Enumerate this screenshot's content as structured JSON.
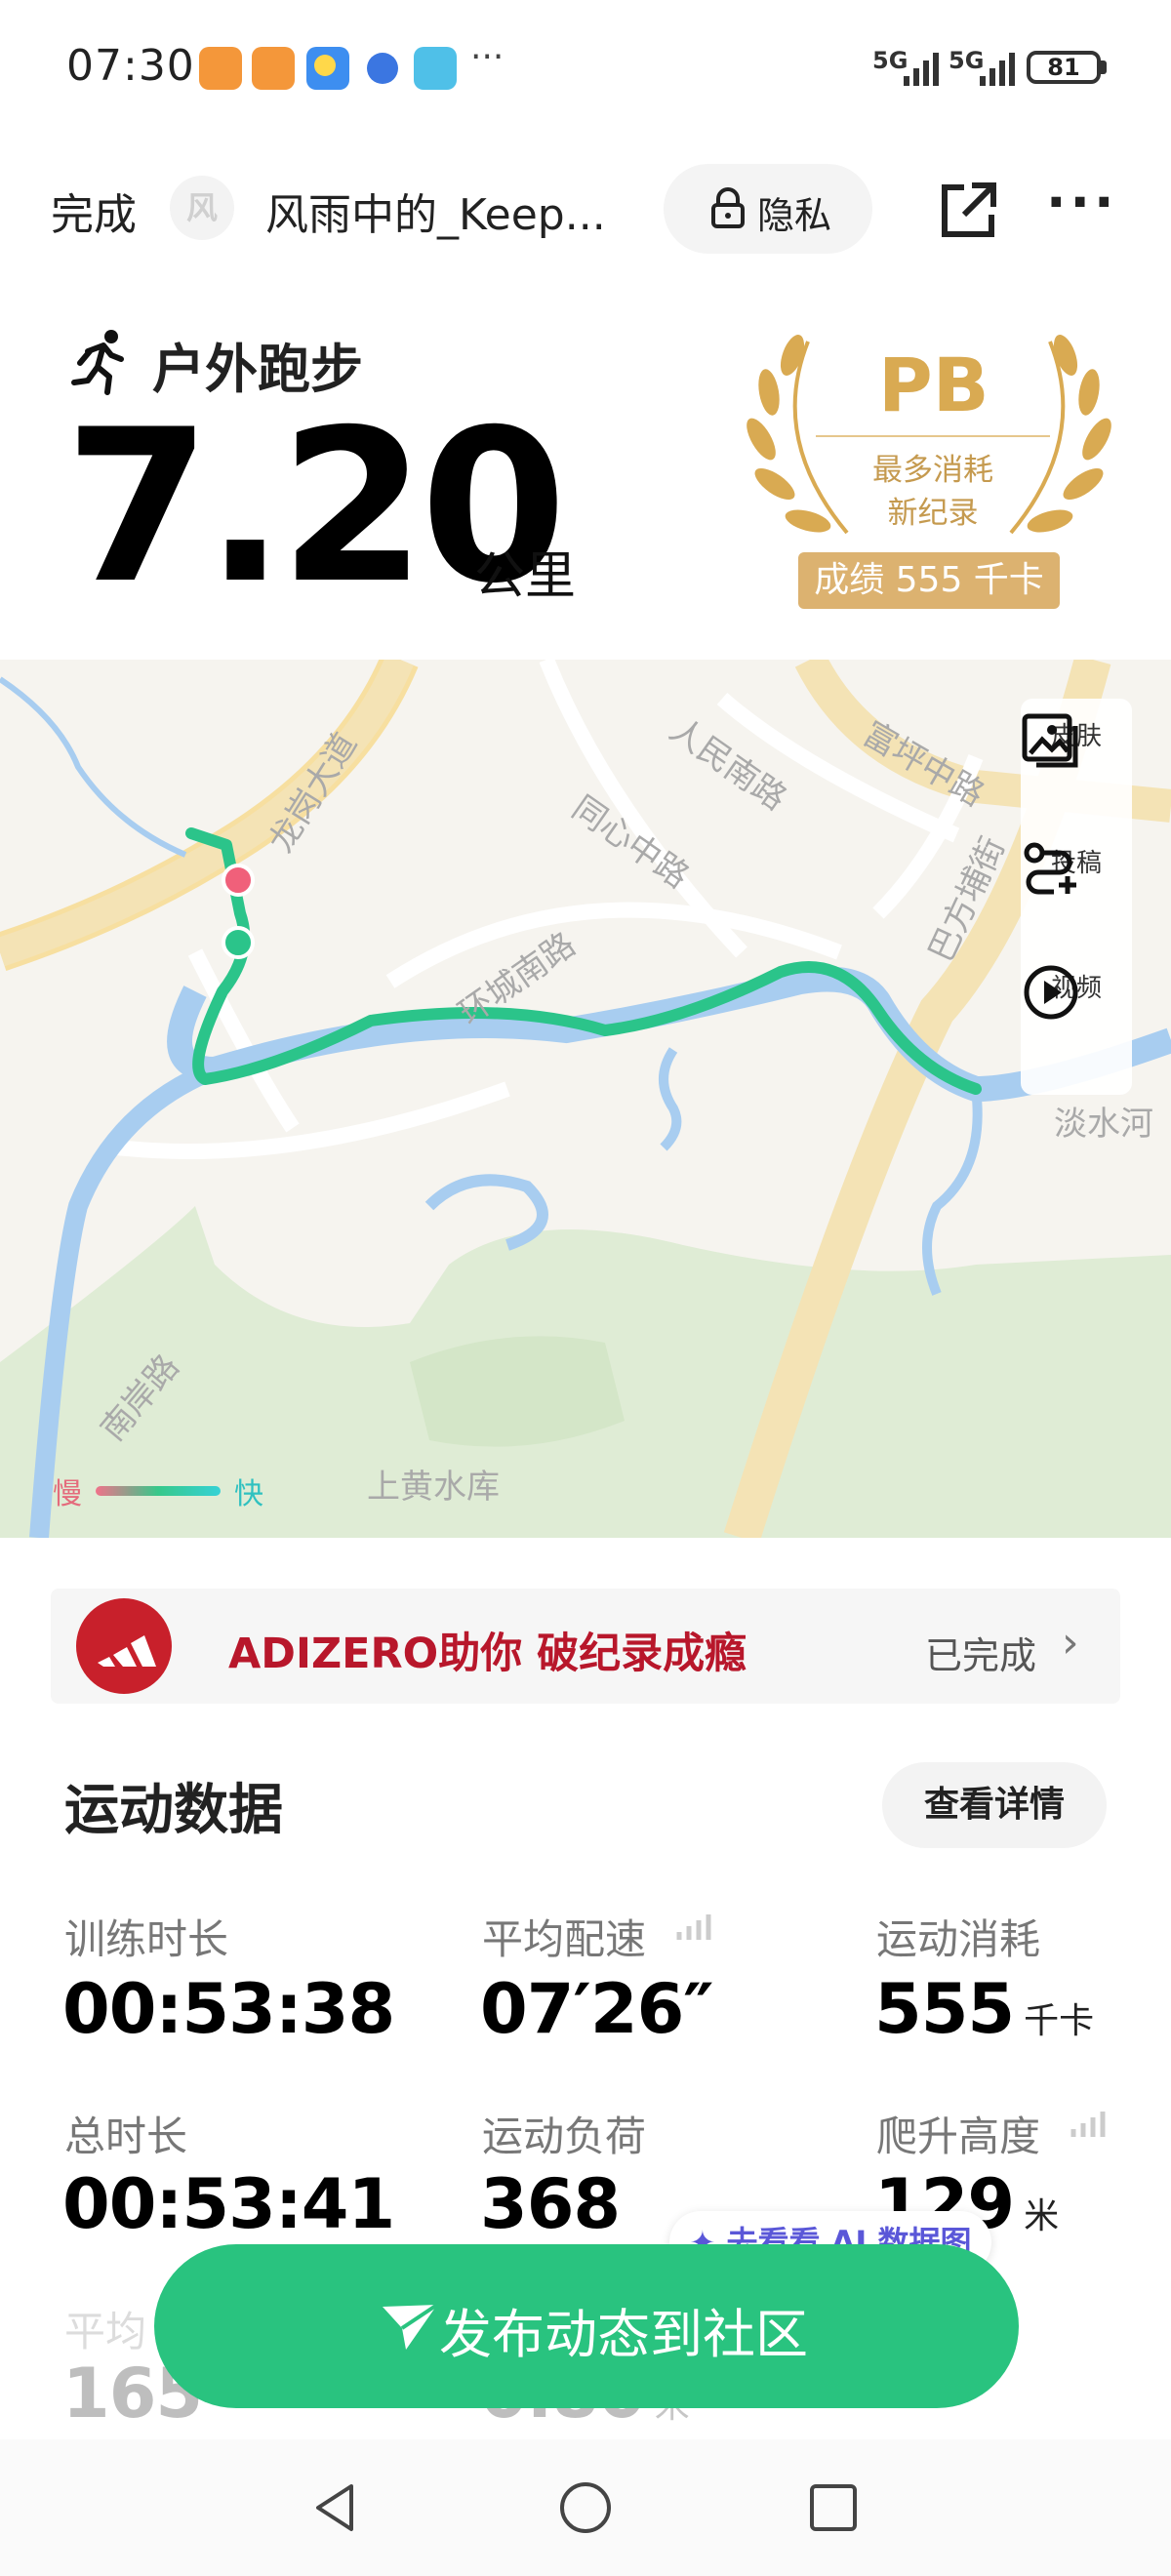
{
  "status_bar": {
    "time": "07:30",
    "more": "···",
    "signal1": "5G",
    "signal2": "5G",
    "battery": "81"
  },
  "header": {
    "done": "完成",
    "avatar_char": "风",
    "username": "风雨中的_Keep...",
    "privacy": "隐私"
  },
  "run": {
    "type": "户外跑步",
    "distance": "7.20",
    "unit": "公里"
  },
  "pb": {
    "title": "PB",
    "line1": "最多消耗",
    "line2": "新纪录",
    "score": "成绩 555 千卡"
  },
  "map": {
    "labels": {
      "r1": "龙岗大道",
      "r2": "人民南路",
      "r3": "富坪中路",
      "r4": "同心中路",
      "r5": "巴方埔街",
      "r6": "环城南路",
      "r7": "淡水河",
      "r8": "南岸路",
      "r9": "上黄水库"
    },
    "tools": [
      {
        "label": "皮肤",
        "icon": "skin-icon"
      },
      {
        "label": "投稿",
        "icon": "route-icon"
      },
      {
        "label": "视频",
        "icon": "play-icon"
      }
    ],
    "legend_slow": "慢",
    "legend_fast": "快"
  },
  "promo": {
    "text": "ADIZERO助你 破纪录成瘾",
    "status": "已完成"
  },
  "stats": {
    "title": "运动数据",
    "details": "查看详情",
    "items": [
      {
        "label": "训练时长",
        "value": "00:53:38",
        "unit": ""
      },
      {
        "label": "平均配速",
        "value": "07′26″",
        "unit": ""
      },
      {
        "label": "运动消耗",
        "value": "555",
        "unit": "千卡"
      },
      {
        "label": "总时长",
        "value": "00:53:41",
        "unit": ""
      },
      {
        "label": "运动负荷",
        "value": "368",
        "unit": ""
      },
      {
        "label": "爬升高度",
        "value": "129",
        "unit": "米"
      },
      {
        "label": "平均",
        "value": "165",
        "unit": ""
      },
      {
        "label": "",
        "value": "0.80",
        "unit": "米"
      }
    ]
  },
  "ai_pill": "去看看 AI 数据图",
  "publish": "发布动态到社区",
  "colors": {
    "accent": "#29c37f",
    "route": "#2bc48a",
    "pb_gold": "#d9aa52",
    "promo_red": "#b8172b"
  }
}
